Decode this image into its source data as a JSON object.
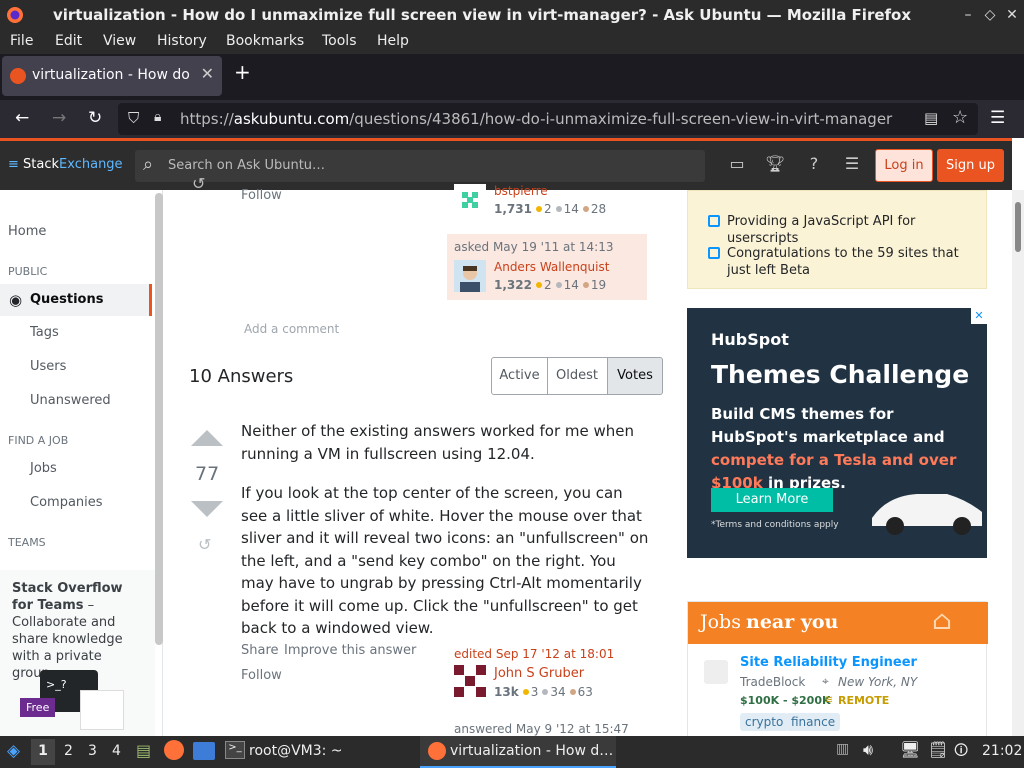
{
  "window": {
    "title": "virtualization - How do I unmaximize full screen view in virt-manager? - Ask Ubuntu — Mozilla Firefox",
    "buttons": {
      "minimize": "–",
      "restore": "◇",
      "close": "✕"
    }
  },
  "menubar": [
    "File",
    "Edit",
    "View",
    "History",
    "Bookmarks",
    "Tools",
    "Help"
  ],
  "tabs": [
    {
      "title": "virtualization - How do I u",
      "close": "✕"
    }
  ],
  "newtab": "+",
  "url": {
    "prefix": "https://",
    "domain": "askubuntu.com",
    "path": "/questions/43861/how-do-i-unmaximize-full-screen-view-in-virt-manager"
  },
  "topbar": {
    "logo_a": "Stack",
    "logo_b": "Exchange",
    "search_placeholder": "Search on Ask Ubuntu…",
    "login": "Log in",
    "signup": "Sign up"
  },
  "leftnav": {
    "home": "Home",
    "public": "PUBLIC",
    "questions": "Questions",
    "tags": "Tags",
    "users": "Users",
    "unanswered": "Unanswered",
    "find_job": "FIND A JOB",
    "jobs": "Jobs",
    "companies": "Companies",
    "teams": "TEAMS",
    "teams_title": "Stack Overflow for Teams",
    "teams_desc": " – Collaborate and share knowledge with a private group.",
    "free": "Free"
  },
  "question_footer": {
    "follow": "Follow",
    "editor": {
      "name": "bstpierre",
      "rep": "1,731",
      "gold": "2",
      "silver": "14",
      "bronze": "28"
    },
    "asked": "asked May 19 '11 at 14:13",
    "asker": {
      "name": "Anders Wallenquist",
      "rep": "1,322",
      "gold": "2",
      "silver": "14",
      "bronze": "19"
    },
    "add_comment": "Add a comment"
  },
  "answers": {
    "heading": "10 Answers",
    "sort": [
      "Active",
      "Oldest",
      "Votes"
    ],
    "selected_sort": "Votes"
  },
  "answer": {
    "votes": "77",
    "p1": "Neither of the existing answers worked for me when running a VM in fullscreen using 12.04.",
    "p2": "If you look at the top center of the screen, you can see a little sliver of white. Hover the mouse over that sliver and it will reveal two icons: an \"unfullscreen\" on the left, and a \"send key combo\" on the right. You may have to ungrab by pressing Ctrl-Alt momentarily before it will come up. Click the \"unfullscreen\" to get back to a windowed view.",
    "share": "Share",
    "improve": "Improve this answer",
    "follow": "Follow",
    "edited": "edited Sep 17 '12 at 18:01",
    "editor": {
      "name": "John S Gruber",
      "rep": "13k",
      "gold": "3",
      "silver": "34",
      "bronze": "63"
    },
    "answered": "answered May 9 '12 at 15:47"
  },
  "bulletin": [
    "Providing a JavaScript API for userscripts",
    "Congratulations to the 59 sites that just left Beta"
  ],
  "ad": {
    "brand": "HubSpot",
    "headline": "Themes Challenge",
    "body_a": "Build CMS themes for HubSpot's marketplace and ",
    "body_b": "compete for a Tesla and over $100k",
    "body_c": " in prizes.",
    "cta": "Learn More",
    "terms": "*Terms and conditions apply"
  },
  "jobs": {
    "title_a": "Jobs",
    "title_b": "near you",
    "job_title": "Site Reliability Engineer",
    "company": "TradeBlock",
    "location": "New York, NY",
    "salary": "$100K - $200K",
    "remote": "REMOTE",
    "tags": [
      "crypto",
      "finance"
    ]
  },
  "taskbar": {
    "workspaces": [
      "1",
      "2",
      "3",
      "4"
    ],
    "terminal": "root@VM3: ~",
    "firefox": "virtualization - How d…",
    "clock": "21:02"
  },
  "colors": {
    "accent": "#e95420",
    "link": "#0a95ff",
    "orange_user": "#c9411a"
  }
}
